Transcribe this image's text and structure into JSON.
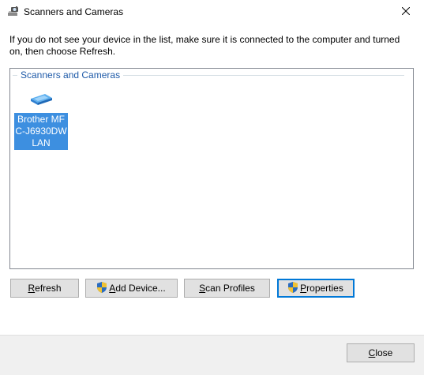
{
  "window": {
    "title": "Scanners and Cameras",
    "icon": "scanner-camera-icon",
    "close_icon": "close-icon"
  },
  "instructions": "If you do not see your device in the list, make sure it is connected to the computer and turned on, then choose Refresh.",
  "group": {
    "title": "Scanners and Cameras"
  },
  "devices": [
    {
      "name": "Brother MFC-J6930DW LAN",
      "icon": "scanner-icon",
      "selected": true
    }
  ],
  "buttons": {
    "refresh": {
      "first": "R",
      "rest": "efresh"
    },
    "add_device": {
      "first": "A",
      "rest": "dd Device...",
      "shield": true
    },
    "scan_profiles": {
      "first": "S",
      "rest": "can Profiles"
    },
    "properties": {
      "first": "P",
      "rest": "roperties",
      "shield": true
    }
  },
  "footer": {
    "close": {
      "first": "C",
      "rest": "lose"
    }
  },
  "colors": {
    "selection": "#3d8fe0",
    "group_title": "#1e5aa8",
    "default_button_border": "#0078d7",
    "footer_bg": "#f0f0f0"
  }
}
